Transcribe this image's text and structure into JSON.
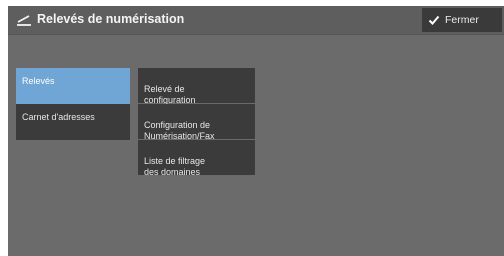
{
  "header": {
    "title": "Relevés de numérisation",
    "title_icon": "arrow-return-icon",
    "close_label": "Fermer",
    "close_icon": "checkmark-icon"
  },
  "nav": {
    "items": [
      {
        "label": "Relevés",
        "selected": true
      },
      {
        "label": "Carnet d'adresses",
        "selected": false
      }
    ]
  },
  "submenu": {
    "items": [
      {
        "label": "Relevé de\nconfiguration"
      },
      {
        "label": "Configuration de\nNumérisation/Fax"
      },
      {
        "label": "Liste de filtrage\ndes domaines"
      }
    ]
  },
  "colors": {
    "background": "#6b6b6b",
    "button": "#3b3b3b",
    "selected": "#6fa6d6"
  }
}
